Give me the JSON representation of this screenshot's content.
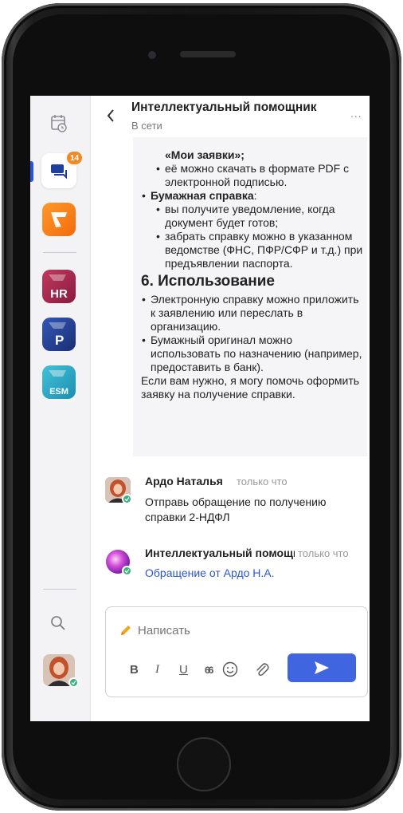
{
  "sidebar": {
    "chat_badge": "14",
    "apps": [
      {
        "name": "orange-app",
        "label": ""
      },
      {
        "name": "hr-app",
        "label": "HR"
      },
      {
        "name": "p-app",
        "label": "P"
      },
      {
        "name": "esm-app",
        "label": "ESM"
      }
    ]
  },
  "header": {
    "title": "Интеллектуальный помощник",
    "status": "В сети",
    "more": "..."
  },
  "bot_message": {
    "line_01": "«Мои заявки»;",
    "line_02": "её можно скачать в формате PDF с электронной подписью.",
    "line_03_bold": "Бумажная справка",
    "line_03_tail": ":",
    "line_04": "вы получите уведомление, когда документ будет готов;",
    "line_05": "забрать справку можно в указанном ведомстве (ФНС, ПФР/СФР и т.д.) при предъявлении паспорта.",
    "heading": "6. Использование",
    "line_06": "Электронную справку можно приложить к заявлению или переслать в организацию.",
    "line_07": "Бумажный оригинал можно использовать по назначению (например, предоставить в банк).",
    "closing": "Если вам нужно, я могу помочь оформить заявку на получение справки."
  },
  "messages": [
    {
      "author": "Ардо Наталья",
      "time": "только что",
      "text": "Отправь обращение по получению справки 2-НДФЛ"
    },
    {
      "author": "Интеллектуальный помощник",
      "time": "только что",
      "link": "Обращение от Ардо Н.А."
    }
  ],
  "composer": {
    "placeholder": "Написать",
    "bold": "B",
    "italic": "I",
    "underline": "U",
    "quote": "66"
  },
  "colors": {
    "accent": "#3f66e0",
    "badge": "#f08a24",
    "online": "#36b37e",
    "link": "#2a55d4"
  }
}
